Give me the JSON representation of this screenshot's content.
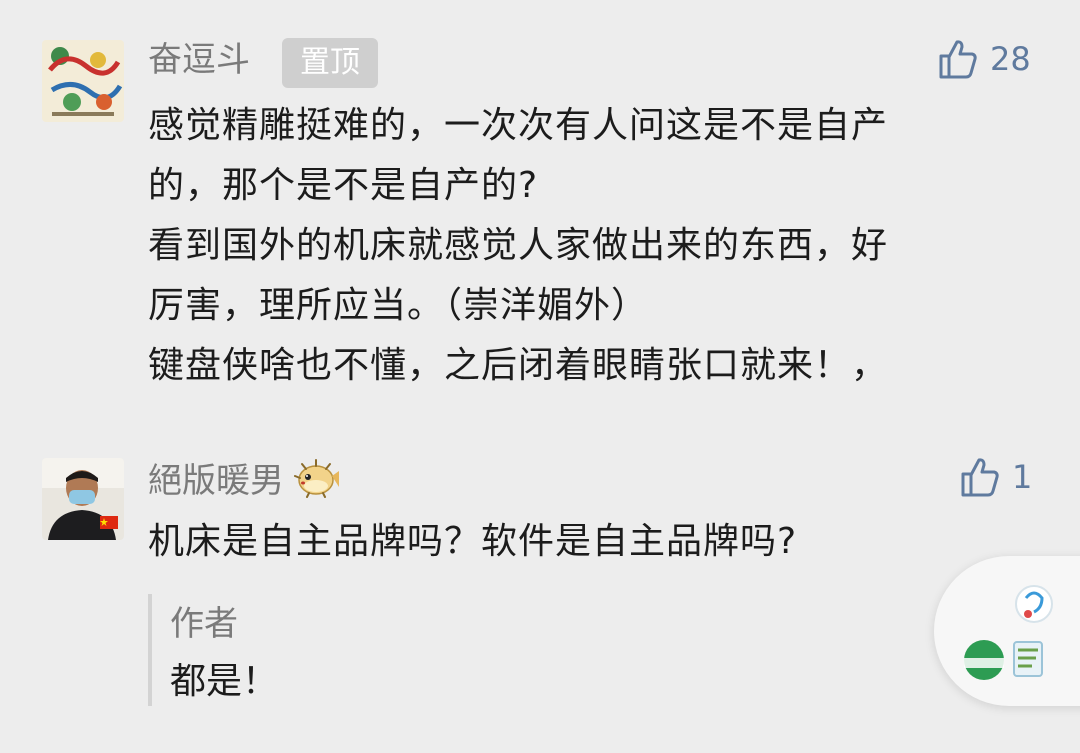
{
  "comments": [
    {
      "nickname": "奋逗斗",
      "badge": "置顶",
      "likes": "28",
      "lines": [
        "感觉精雕挺难的，一次次有人问这是不是自产",
        "的，那个是不是自产的?",
        "看到国外的机床就感觉人家做出来的东西，好",
        "厉害，理所应当。（崇洋媚外）",
        "键盘侠啥也不懂，之后闭着眼睛张口就来！，"
      ]
    },
    {
      "nickname": "絕版暖男",
      "nickname_icon": "pufferfish-emoji-icon",
      "likes": "1",
      "text": "机床是自主品牌吗？软件是自主品牌吗?",
      "reply": {
        "author": "作者",
        "text": "都是！"
      }
    }
  ],
  "colors": {
    "background": "#ededed",
    "like_blue": "#5f7a9e",
    "nickname_gray": "#7a7a7a",
    "badge_bg": "#cfcfcf"
  }
}
